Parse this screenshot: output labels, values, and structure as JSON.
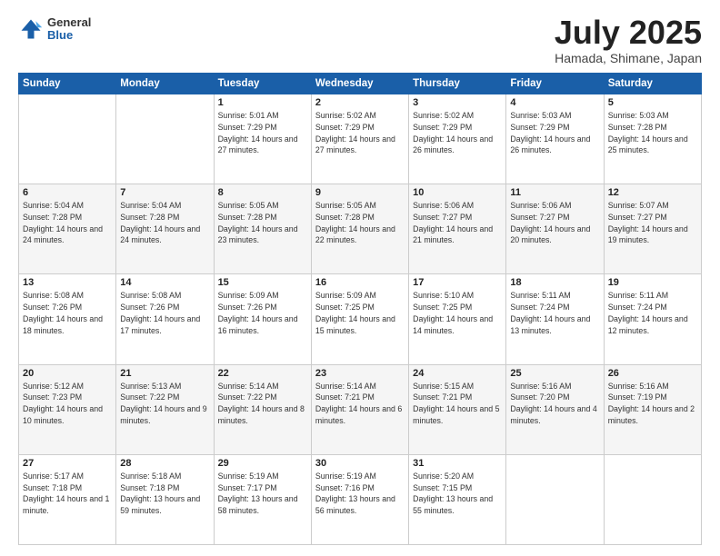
{
  "header": {
    "logo": {
      "general": "General",
      "blue": "Blue"
    },
    "title": "July 2025",
    "location": "Hamada, Shimane, Japan"
  },
  "columns": [
    "Sunday",
    "Monday",
    "Tuesday",
    "Wednesday",
    "Thursday",
    "Friday",
    "Saturday"
  ],
  "weeks": [
    [
      {
        "day": "",
        "detail": ""
      },
      {
        "day": "",
        "detail": ""
      },
      {
        "day": "1",
        "detail": "Sunrise: 5:01 AM\nSunset: 7:29 PM\nDaylight: 14 hours and 27 minutes."
      },
      {
        "day": "2",
        "detail": "Sunrise: 5:02 AM\nSunset: 7:29 PM\nDaylight: 14 hours and 27 minutes."
      },
      {
        "day": "3",
        "detail": "Sunrise: 5:02 AM\nSunset: 7:29 PM\nDaylight: 14 hours and 26 minutes."
      },
      {
        "day": "4",
        "detail": "Sunrise: 5:03 AM\nSunset: 7:29 PM\nDaylight: 14 hours and 26 minutes."
      },
      {
        "day": "5",
        "detail": "Sunrise: 5:03 AM\nSunset: 7:28 PM\nDaylight: 14 hours and 25 minutes."
      }
    ],
    [
      {
        "day": "6",
        "detail": "Sunrise: 5:04 AM\nSunset: 7:28 PM\nDaylight: 14 hours and 24 minutes."
      },
      {
        "day": "7",
        "detail": "Sunrise: 5:04 AM\nSunset: 7:28 PM\nDaylight: 14 hours and 24 minutes."
      },
      {
        "day": "8",
        "detail": "Sunrise: 5:05 AM\nSunset: 7:28 PM\nDaylight: 14 hours and 23 minutes."
      },
      {
        "day": "9",
        "detail": "Sunrise: 5:05 AM\nSunset: 7:28 PM\nDaylight: 14 hours and 22 minutes."
      },
      {
        "day": "10",
        "detail": "Sunrise: 5:06 AM\nSunset: 7:27 PM\nDaylight: 14 hours and 21 minutes."
      },
      {
        "day": "11",
        "detail": "Sunrise: 5:06 AM\nSunset: 7:27 PM\nDaylight: 14 hours and 20 minutes."
      },
      {
        "day": "12",
        "detail": "Sunrise: 5:07 AM\nSunset: 7:27 PM\nDaylight: 14 hours and 19 minutes."
      }
    ],
    [
      {
        "day": "13",
        "detail": "Sunrise: 5:08 AM\nSunset: 7:26 PM\nDaylight: 14 hours and 18 minutes."
      },
      {
        "day": "14",
        "detail": "Sunrise: 5:08 AM\nSunset: 7:26 PM\nDaylight: 14 hours and 17 minutes."
      },
      {
        "day": "15",
        "detail": "Sunrise: 5:09 AM\nSunset: 7:26 PM\nDaylight: 14 hours and 16 minutes."
      },
      {
        "day": "16",
        "detail": "Sunrise: 5:09 AM\nSunset: 7:25 PM\nDaylight: 14 hours and 15 minutes."
      },
      {
        "day": "17",
        "detail": "Sunrise: 5:10 AM\nSunset: 7:25 PM\nDaylight: 14 hours and 14 minutes."
      },
      {
        "day": "18",
        "detail": "Sunrise: 5:11 AM\nSunset: 7:24 PM\nDaylight: 14 hours and 13 minutes."
      },
      {
        "day": "19",
        "detail": "Sunrise: 5:11 AM\nSunset: 7:24 PM\nDaylight: 14 hours and 12 minutes."
      }
    ],
    [
      {
        "day": "20",
        "detail": "Sunrise: 5:12 AM\nSunset: 7:23 PM\nDaylight: 14 hours and 10 minutes."
      },
      {
        "day": "21",
        "detail": "Sunrise: 5:13 AM\nSunset: 7:22 PM\nDaylight: 14 hours and 9 minutes."
      },
      {
        "day": "22",
        "detail": "Sunrise: 5:14 AM\nSunset: 7:22 PM\nDaylight: 14 hours and 8 minutes."
      },
      {
        "day": "23",
        "detail": "Sunrise: 5:14 AM\nSunset: 7:21 PM\nDaylight: 14 hours and 6 minutes."
      },
      {
        "day": "24",
        "detail": "Sunrise: 5:15 AM\nSunset: 7:21 PM\nDaylight: 14 hours and 5 minutes."
      },
      {
        "day": "25",
        "detail": "Sunrise: 5:16 AM\nSunset: 7:20 PM\nDaylight: 14 hours and 4 minutes."
      },
      {
        "day": "26",
        "detail": "Sunrise: 5:16 AM\nSunset: 7:19 PM\nDaylight: 14 hours and 2 minutes."
      }
    ],
    [
      {
        "day": "27",
        "detail": "Sunrise: 5:17 AM\nSunset: 7:18 PM\nDaylight: 14 hours and 1 minute."
      },
      {
        "day": "28",
        "detail": "Sunrise: 5:18 AM\nSunset: 7:18 PM\nDaylight: 13 hours and 59 minutes."
      },
      {
        "day": "29",
        "detail": "Sunrise: 5:19 AM\nSunset: 7:17 PM\nDaylight: 13 hours and 58 minutes."
      },
      {
        "day": "30",
        "detail": "Sunrise: 5:19 AM\nSunset: 7:16 PM\nDaylight: 13 hours and 56 minutes."
      },
      {
        "day": "31",
        "detail": "Sunrise: 5:20 AM\nSunset: 7:15 PM\nDaylight: 13 hours and 55 minutes."
      },
      {
        "day": "",
        "detail": ""
      },
      {
        "day": "",
        "detail": ""
      }
    ]
  ]
}
